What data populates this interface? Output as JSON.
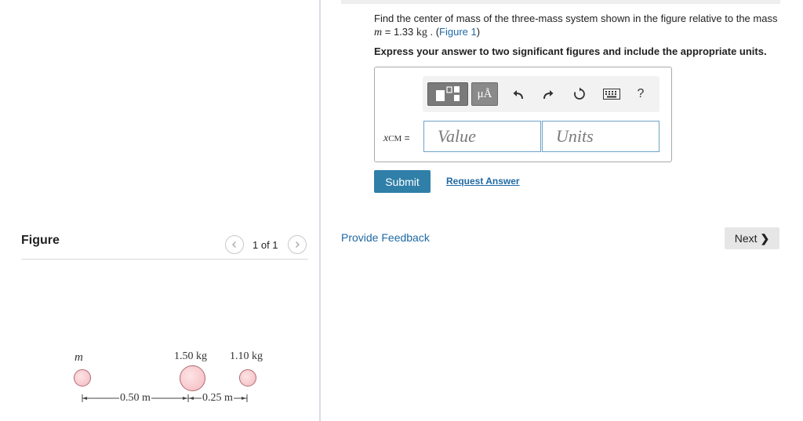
{
  "question": {
    "text_before": "Find the center of mass of the three-mass system shown in the figure relative to the mass ",
    "mass_var": "m",
    "mass_eq": " = 1.33 ",
    "mass_unit": "kg",
    "text_after": " . (",
    "figure_link": "Figure 1",
    "close_paren": ")",
    "instruction": "Express your answer to two significant figures and include the appropriate units."
  },
  "answer": {
    "label_var": "x",
    "label_sub": "CM",
    "label_eq": " =",
    "value_placeholder": "Value",
    "units_placeholder": "Units",
    "units_button": "μÅ",
    "help_button": "?"
  },
  "actions": {
    "submit": "Submit",
    "request_answer": "Request Answer",
    "provide_feedback": "Provide Feedback",
    "next": "Next",
    "next_chevron": "❯"
  },
  "figure": {
    "title": "Figure",
    "pager_text": "1 of 1",
    "mass_labels": [
      "m",
      "1.50 kg",
      "1.10 kg"
    ],
    "distance_labels": [
      "0.50 m",
      "0.25 m"
    ]
  },
  "colors": {
    "accent": "#2f7fa8",
    "link": "#1f6aa5",
    "ball_fill": "#f4b9bf"
  }
}
